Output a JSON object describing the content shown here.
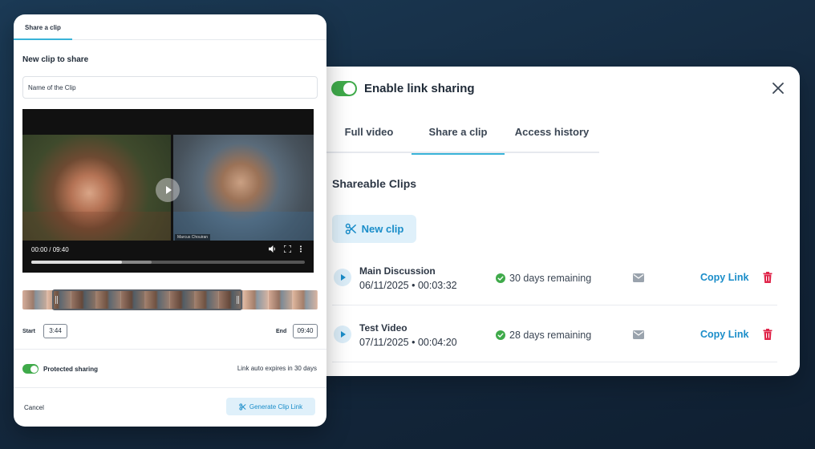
{
  "share_panel": {
    "toggle_label": "Enable link sharing",
    "tabs": [
      {
        "label": "Full video"
      },
      {
        "label": "Share a clip"
      },
      {
        "label": "Access history"
      }
    ],
    "section_title": "Shareable Clips",
    "new_clip_label": "New clip",
    "clips": [
      {
        "name": "Main Discussion",
        "date": "06/11/2025 • 00:03:32",
        "remaining": "30 days remaining",
        "copy_label": "Copy Link"
      },
      {
        "name": "Test Video",
        "date": "07/11/2025 • 00:04:20",
        "remaining": "28 days remaining",
        "copy_label": "Copy Link"
      }
    ]
  },
  "clip_panel": {
    "tab_label": "Share a clip",
    "title": "New clip to share",
    "name_input_value": "Name of the Clip",
    "video": {
      "time_display": "00:00 / 09:40",
      "participant_name": "Marcus Chouiran",
      "progress_fraction": 0.0,
      "buffered_fraction": 0.33,
      "played_fraction": 0.44
    },
    "start_label": "Start",
    "start_value": "3:44",
    "end_label": "End",
    "end_value": "09:40",
    "protected_label": "Protected sharing",
    "expires_text": "Link auto expires in 30 days",
    "cancel_label": "Cancel",
    "generate_label": "Generate Clip Link"
  },
  "colors": {
    "accent": "#1a8dc9",
    "toggle_on": "#3faa4a",
    "tab_active": "#39b3d8",
    "danger": "#e0264b",
    "success": "#3faa4a"
  }
}
